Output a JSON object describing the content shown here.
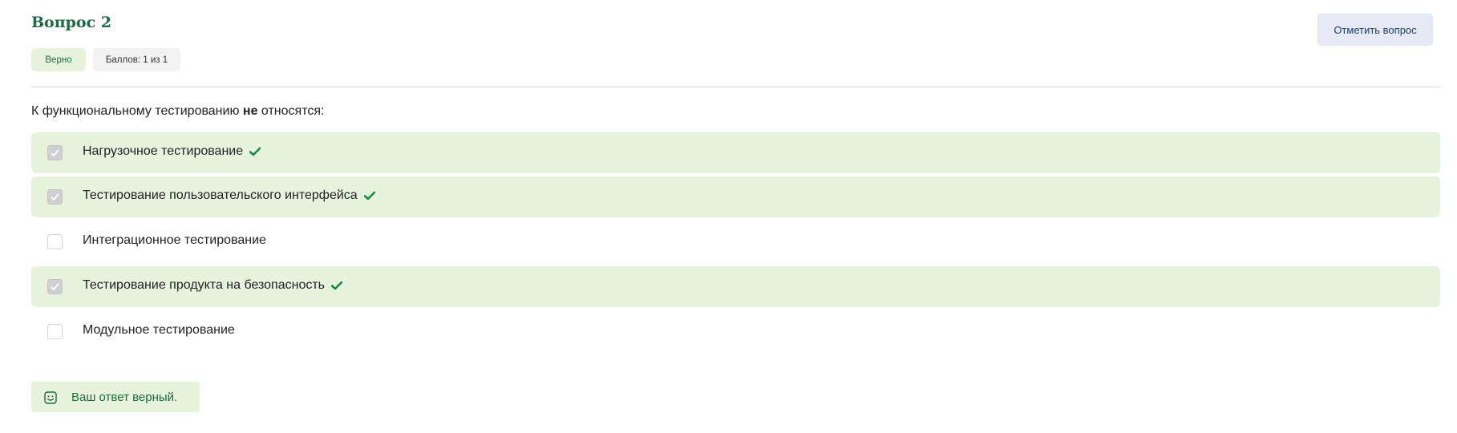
{
  "question": {
    "title": "Вопрос 2",
    "flag_button_label": "Отметить вопрос",
    "status_badge": "Верно",
    "score_badge": "Баллов: 1 из 1",
    "text_before": "К функциональному тестированию ",
    "text_bold": "не",
    "text_after": " относятся:"
  },
  "answers": [
    {
      "label": "Нагрузочное тестирование",
      "checked": true,
      "marked_correct": true
    },
    {
      "label": "Тестирование пользовательского интерфейса",
      "checked": true,
      "marked_correct": true
    },
    {
      "label": "Интеграционное тестирование",
      "checked": false,
      "marked_correct": false
    },
    {
      "label": "Тестирование продукта на безопасность",
      "checked": true,
      "marked_correct": true
    },
    {
      "label": "Модульное тестирование",
      "checked": false,
      "marked_correct": false
    }
  ],
  "feedback": {
    "text": "Ваш ответ верный.",
    "icon": "smile-icon"
  },
  "colors": {
    "accent_green": "#1e6a43",
    "correct_bg": "#e8f3de",
    "check_mark": "#1a8a3c",
    "flag_bg": "#e5eaf4"
  }
}
